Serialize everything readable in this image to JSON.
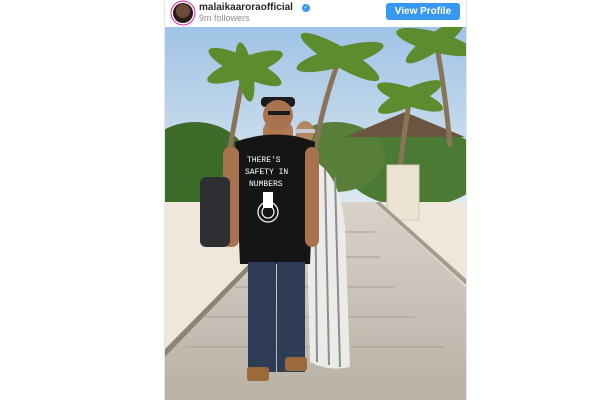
{
  "post": {
    "username": "malaikaaroraofficial",
    "followers": "9m followers",
    "verified_icon": "✓",
    "view_profile_label": "View Profile"
  },
  "photo": {
    "tshirt_text_line1": "THERE'S",
    "tshirt_text_line2": "SAFETY IN",
    "tshirt_text_line3": "NUMBERS"
  },
  "colors": {
    "button_blue": "#3897f0",
    "sky": "#a9c9e6",
    "sand": "#efe6dc",
    "boardwalk": "#c9c2b8"
  }
}
